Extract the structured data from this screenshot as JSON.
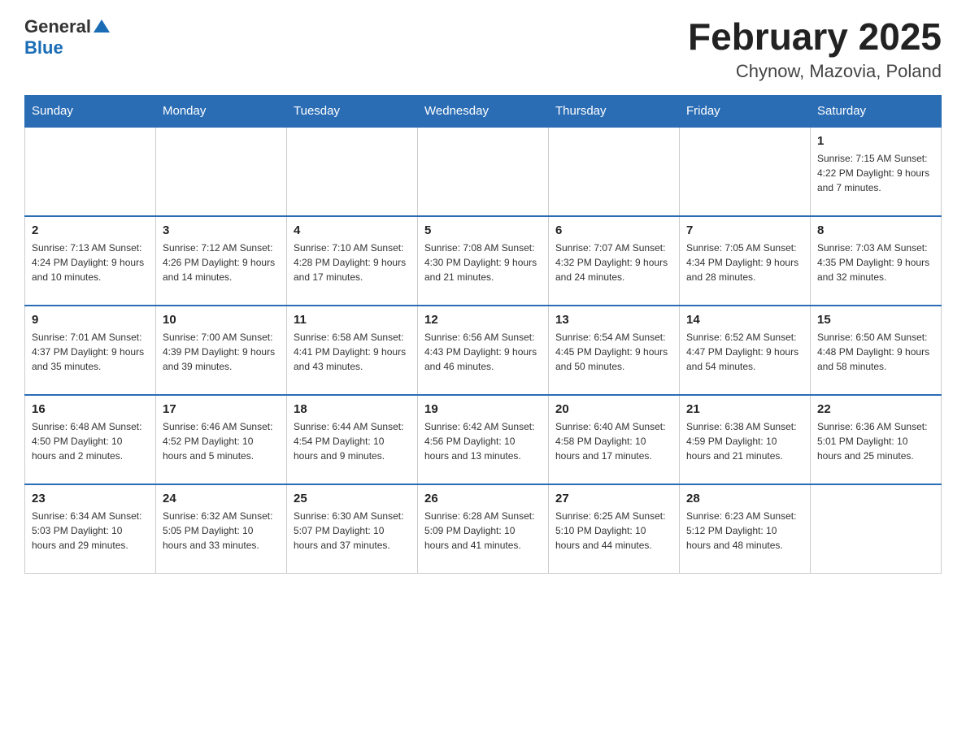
{
  "header": {
    "logo_general": "General",
    "logo_blue": "Blue",
    "month_title": "February 2025",
    "location": "Chynow, Mazovia, Poland"
  },
  "weekdays": [
    "Sunday",
    "Monday",
    "Tuesday",
    "Wednesday",
    "Thursday",
    "Friday",
    "Saturday"
  ],
  "weeks": [
    [
      {
        "day": "",
        "info": ""
      },
      {
        "day": "",
        "info": ""
      },
      {
        "day": "",
        "info": ""
      },
      {
        "day": "",
        "info": ""
      },
      {
        "day": "",
        "info": ""
      },
      {
        "day": "",
        "info": ""
      },
      {
        "day": "1",
        "info": "Sunrise: 7:15 AM\nSunset: 4:22 PM\nDaylight: 9 hours and 7 minutes."
      }
    ],
    [
      {
        "day": "2",
        "info": "Sunrise: 7:13 AM\nSunset: 4:24 PM\nDaylight: 9 hours and 10 minutes."
      },
      {
        "day": "3",
        "info": "Sunrise: 7:12 AM\nSunset: 4:26 PM\nDaylight: 9 hours and 14 minutes."
      },
      {
        "day": "4",
        "info": "Sunrise: 7:10 AM\nSunset: 4:28 PM\nDaylight: 9 hours and 17 minutes."
      },
      {
        "day": "5",
        "info": "Sunrise: 7:08 AM\nSunset: 4:30 PM\nDaylight: 9 hours and 21 minutes."
      },
      {
        "day": "6",
        "info": "Sunrise: 7:07 AM\nSunset: 4:32 PM\nDaylight: 9 hours and 24 minutes."
      },
      {
        "day": "7",
        "info": "Sunrise: 7:05 AM\nSunset: 4:34 PM\nDaylight: 9 hours and 28 minutes."
      },
      {
        "day": "8",
        "info": "Sunrise: 7:03 AM\nSunset: 4:35 PM\nDaylight: 9 hours and 32 minutes."
      }
    ],
    [
      {
        "day": "9",
        "info": "Sunrise: 7:01 AM\nSunset: 4:37 PM\nDaylight: 9 hours and 35 minutes."
      },
      {
        "day": "10",
        "info": "Sunrise: 7:00 AM\nSunset: 4:39 PM\nDaylight: 9 hours and 39 minutes."
      },
      {
        "day": "11",
        "info": "Sunrise: 6:58 AM\nSunset: 4:41 PM\nDaylight: 9 hours and 43 minutes."
      },
      {
        "day": "12",
        "info": "Sunrise: 6:56 AM\nSunset: 4:43 PM\nDaylight: 9 hours and 46 minutes."
      },
      {
        "day": "13",
        "info": "Sunrise: 6:54 AM\nSunset: 4:45 PM\nDaylight: 9 hours and 50 minutes."
      },
      {
        "day": "14",
        "info": "Sunrise: 6:52 AM\nSunset: 4:47 PM\nDaylight: 9 hours and 54 minutes."
      },
      {
        "day": "15",
        "info": "Sunrise: 6:50 AM\nSunset: 4:48 PM\nDaylight: 9 hours and 58 minutes."
      }
    ],
    [
      {
        "day": "16",
        "info": "Sunrise: 6:48 AM\nSunset: 4:50 PM\nDaylight: 10 hours and 2 minutes."
      },
      {
        "day": "17",
        "info": "Sunrise: 6:46 AM\nSunset: 4:52 PM\nDaylight: 10 hours and 5 minutes."
      },
      {
        "day": "18",
        "info": "Sunrise: 6:44 AM\nSunset: 4:54 PM\nDaylight: 10 hours and 9 minutes."
      },
      {
        "day": "19",
        "info": "Sunrise: 6:42 AM\nSunset: 4:56 PM\nDaylight: 10 hours and 13 minutes."
      },
      {
        "day": "20",
        "info": "Sunrise: 6:40 AM\nSunset: 4:58 PM\nDaylight: 10 hours and 17 minutes."
      },
      {
        "day": "21",
        "info": "Sunrise: 6:38 AM\nSunset: 4:59 PM\nDaylight: 10 hours and 21 minutes."
      },
      {
        "day": "22",
        "info": "Sunrise: 6:36 AM\nSunset: 5:01 PM\nDaylight: 10 hours and 25 minutes."
      }
    ],
    [
      {
        "day": "23",
        "info": "Sunrise: 6:34 AM\nSunset: 5:03 PM\nDaylight: 10 hours and 29 minutes."
      },
      {
        "day": "24",
        "info": "Sunrise: 6:32 AM\nSunset: 5:05 PM\nDaylight: 10 hours and 33 minutes."
      },
      {
        "day": "25",
        "info": "Sunrise: 6:30 AM\nSunset: 5:07 PM\nDaylight: 10 hours and 37 minutes."
      },
      {
        "day": "26",
        "info": "Sunrise: 6:28 AM\nSunset: 5:09 PM\nDaylight: 10 hours and 41 minutes."
      },
      {
        "day": "27",
        "info": "Sunrise: 6:25 AM\nSunset: 5:10 PM\nDaylight: 10 hours and 44 minutes."
      },
      {
        "day": "28",
        "info": "Sunrise: 6:23 AM\nSunset: 5:12 PM\nDaylight: 10 hours and 48 minutes."
      },
      {
        "day": "",
        "info": ""
      }
    ]
  ]
}
